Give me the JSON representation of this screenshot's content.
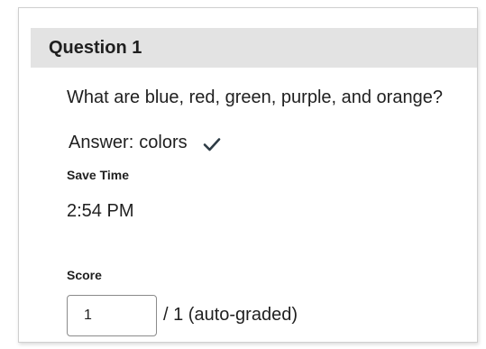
{
  "question": {
    "title": "Question 1",
    "text": "What are blue, red, green, purple, and orange?"
  },
  "answer": {
    "prefix": "Answer:",
    "value": "colors",
    "status_icon": "checkmark-icon"
  },
  "save_time": {
    "label": "Save Time",
    "value": "2:54 PM"
  },
  "score": {
    "label": "Score",
    "value": "1",
    "suffix": "/ 1  (auto-graded)"
  },
  "colors": {
    "header_bg": "#e3e3e3",
    "text": "#1f1f1f",
    "border": "#cfcfcf"
  }
}
